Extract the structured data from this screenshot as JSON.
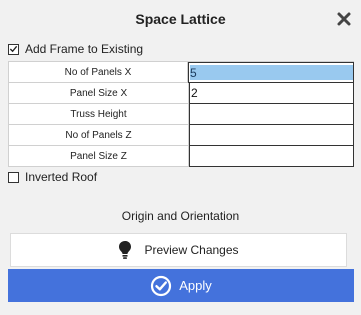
{
  "window": {
    "title": "Space Lattice",
    "close_icon": "close-icon"
  },
  "options": {
    "add_frame": {
      "label": "Add Frame to Existing",
      "checked": true
    },
    "inverted_roof": {
      "label": "Inverted Roof",
      "checked": false
    }
  },
  "params": [
    {
      "label": "No of Panels X",
      "value": "5",
      "selected": true
    },
    {
      "label": "Panel Size X",
      "value": "2"
    },
    {
      "label": "Truss Height",
      "value": ""
    },
    {
      "label": "No of Panels Z",
      "value": ""
    },
    {
      "label": "Panel Size Z",
      "value": ""
    }
  ],
  "sections": {
    "origin": "Origin and Orientation"
  },
  "buttons": {
    "preview": {
      "label": "Preview Changes",
      "icon": "lightbulb-icon"
    },
    "apply": {
      "label": "Apply",
      "icon": "check-circle-icon"
    }
  },
  "colors": {
    "accent": "#4472dc",
    "selection": "#99c9ef",
    "background": "#f1f1f1"
  }
}
